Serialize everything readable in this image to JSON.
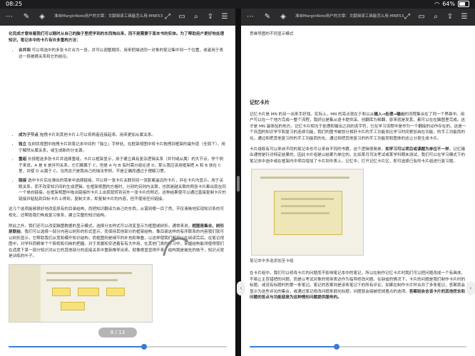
{
  "status": {
    "time": "08:25",
    "battery": "64%",
    "battery_level": 0.64
  },
  "left": {
    "title": "准自MarginNote用户的文章：文献阅读工具能怎么用-MNE53",
    "intro": "化完成才意味着我们可以随时从自己的脑子里把学到的东西掏出来，而不是需要于某本书的实体。为了帮助用户更好地处理知识，笔记本中的卡片有许多重构方法：",
    "bullets1": [
      {
        "term": "合并到",
        "text": "可以将选中的多张卡片合为一张，并可以调整顺序。用来把描述同一对象的笔记集中到一个位置，或者用于表达一段被摘关系和它的结论。"
      }
    ],
    "bullets2": [
      {
        "term": "成为子节点",
        "text": "拖拽卡片到其他卡片上可以将两者连接起来。用来更加从属关系。"
      },
      {
        "term": "独立",
        "text": "在树状视图中拖拽卡片到笔记本中间的「独立」字样处。在框架视图中将卡片拖拽到框架的最外层（全局下），用于解除从属关系，或生成新的分支源。"
      },
      {
        "term": "重组",
        "text": "长按框选多张卡片并选择重组。卡片以框架显示，用于建立具有复杂逻辑关系（并列或从属）的大节点。举个例子来说，A 是 B 是并列关系，它们都属于 C，但是 A 与 B 有时需分组论述 D，那么我应该用框架把 A 和 B 放在 C 里，并使 D 从属于 C。当然这只是我自己的描法举例，不是正确而通过于理解习惯。"
      },
      {
        "term": "链接",
        "text": "选中卡片后在弹出的菜单中选择链接，可以将一张卡片关联到另一张距离遥远的卡片，并在卡片内显示。用于关联关系，而不改变知识间的生成逻辑。在框架视图的方格时，分别的另则内关联，也就是越关联的两张卡片都出现在同一个单向链接。在框架视图中拖出链接的卡片上出现就转到另外一张卡片的附近。这种结果使可以通过直接复制卡片的链接并粘贴到目标卡片上得到，复制文本，即复制卡片的内容，但不使用任何链接。"
      }
    ],
    "para2": "这几个选项能够很好地改变原有的目录结构，而把知识翻译为自己的东西，从需到哪一目了然，不仅清晰地实现知识系的可视化，还帮助我们构成复习体系，建立完整的知识结构。",
    "para3_pre": "除此之外，我们还可以改变脑图数据的显示模式，选择分支样式可以改变显示为框图或树形。通常来说，",
    "para3_bold": "框图是集合，树形是联结",
    "para3_post": "。我们可以选择一部分内容以树形的形式显示，而保持其他部分的框架结构。像目录这样的有序联系的内容我们就可以树形显示，它帮助我们从宽和模开知识结构，而框图则是细节的补充和堆叠，以这样使我们都可以在阅读完后。在笔记视图中，对学科而精单个个俯视和归纳的把握。对于发展和安进着有有大作用，在其他门类的学习中，掌握结构能领使得我们在适度下某一部分知识对从它的其他部分的连接关系中重新推导出来。就像根显显得开来，结构我是被处的核干，知识点就是训练的叶子。",
    "badge": "8 / 13",
    "progress": 0.62
  },
  "right": {
    "top_text": "思维导图的不同显示模式",
    "heading": "记忆卡片",
    "p1_pre": "记忆卡片是 MN 的另一出来手好戏。实际上，MN 的亮点就在于和以从",
    "p1_bold": "输入→处理→输出",
    "p1_post": "的流程集合在了同一个界面中。用户可以在一个地方完成一整个流程，我好比是集从逐卡提供采、创翻库为释翻，原来就是发其，都可以在在脑图里完成。这才是 MN 最体验的地方。记忆卡片相当于处理和输出之间的连宇符，它在学习流程中是作为一个翻接的动作存在的。这是一个巩固的知识学节和复习的连续功能，我们的图书被划分相好卡片的手工功能发比学习时间更加自在功能，的手工功能而的化。通过和把其他复习的的手工功能而的化。通过和把其他复习的的手工功能而和图体的这让分类生成卡片。",
    "p2_pre": "卡片组既有可以来自不同的笔记本也可以来自不同的书籍，这个逻辑很简单，",
    "p2_bold": "和学习可以项目或课题为单位不一样",
    "p2_post": "，记忆输出通常是针对特定结果的，因此卡片组是以结果为单位的。比如某月司法考试或某学科期末测试，我们可以在学习模式下的笔记本中选中或在框架内中项目增加了卡片到中表上，记忆中，打开记忆卡片区，即可选择已有的卡片组进行复习题。",
    "caption": "笔记本中多选添加至卡组",
    "p3_pre": "在卡片组中，我们可以修改卡片的问题而不影响笔记本中的笔记，所以在制作记忆卡片时我们可以把问题改成一个有具体、不易让主旨错把的问题，而是以考试对象的常用表达作为指导修改问题。在缺省的情况下，卡片的问题是我们制作卡片时的标题，或没有标题时的第一条笔记。笔记的答案则是该条笔记下的所有评论。如果在制作卡片时合并了多条笔记，答案就会显示为这些评论的集合，或通过笔记修改问题来弱化标题，问题就会接被挖掉童点的选项。",
    "p3_bold": "答案则会含该卡片的其他挖去和问题的答点与功能就是为这种情形问题提供服务的。",
    "progress": 0.4
  },
  "icons": {
    "toolbar": [
      "pencil-icon",
      "layers-icon",
      "fullscreen-icon",
      "sidebar-icon",
      "search-icon",
      "share-icon",
      "list-icon"
    ]
  },
  "colors": {
    "accent": "#3a7bd5",
    "toolbar": "#2c2c2e"
  }
}
